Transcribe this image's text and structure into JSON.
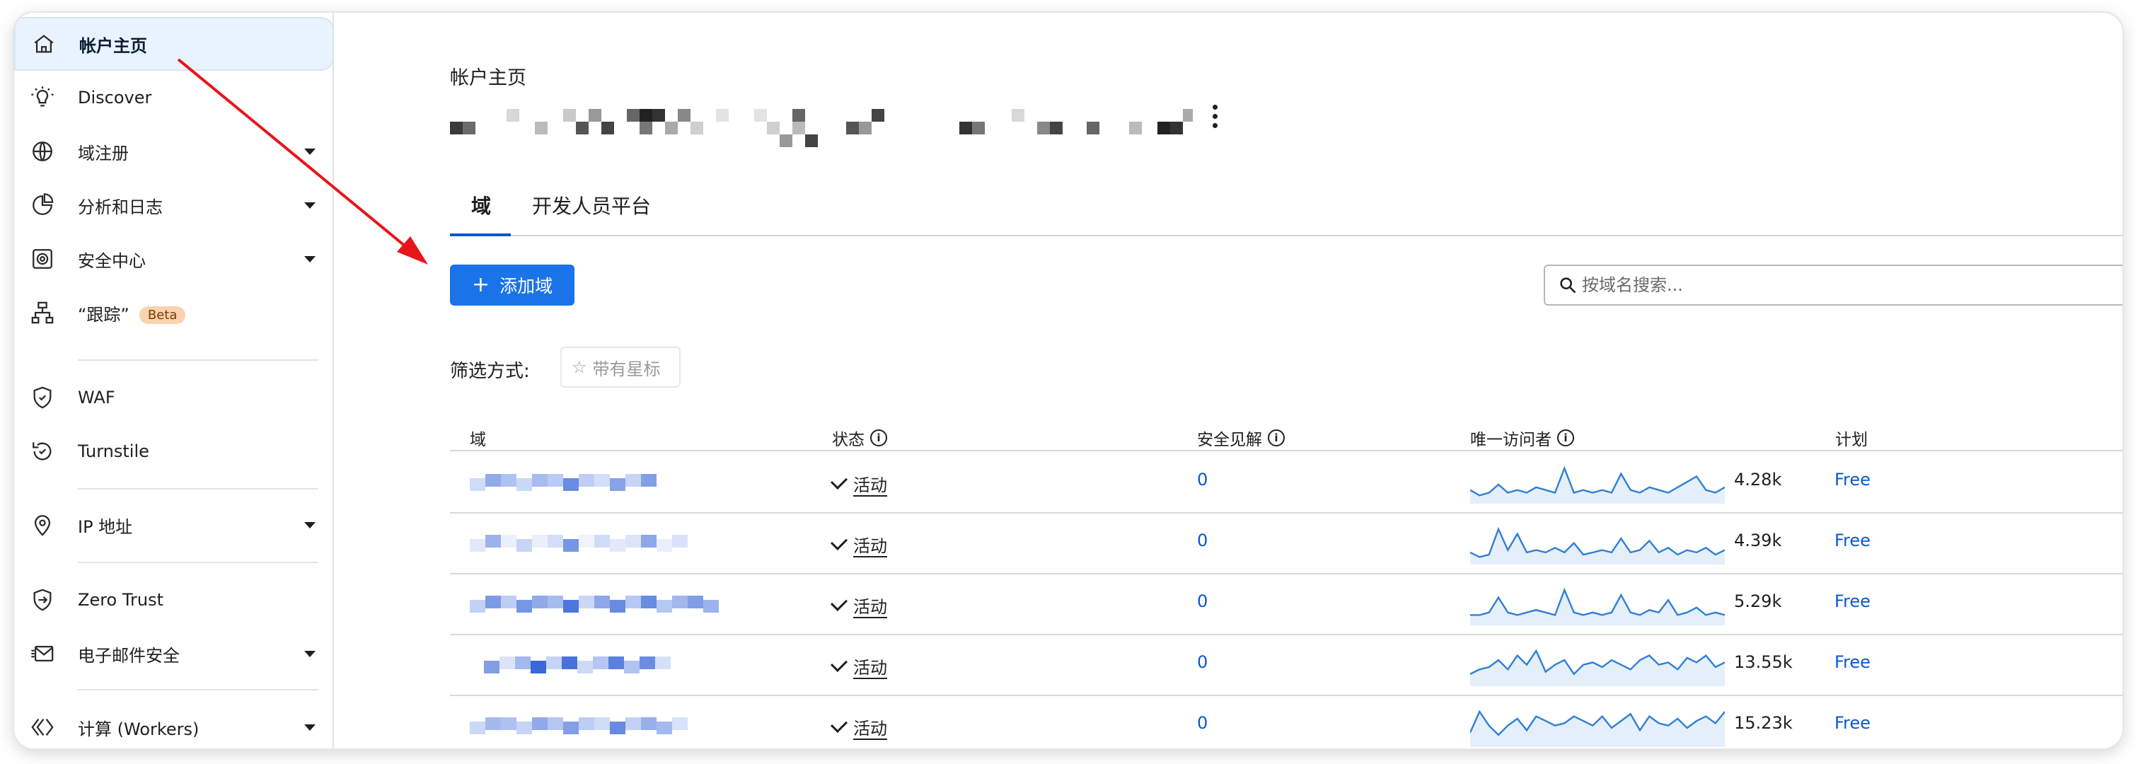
{
  "sidebar": {
    "items": [
      {
        "label": "帐户主页",
        "icon": "home-icon",
        "active": true
      },
      {
        "label": "Discover",
        "icon": "lightbulb-icon"
      },
      {
        "label": "域注册",
        "icon": "globe-icon",
        "expandable": true
      },
      {
        "label": "分析和日志",
        "icon": "pie-chart-icon",
        "expandable": true
      },
      {
        "label": "安全中心",
        "icon": "shield-icon",
        "expandable": true
      },
      {
        "label": "“跟踪”",
        "icon": "sitemap-icon",
        "badge": "Beta"
      },
      {
        "label": "WAF",
        "icon": "waf-icon"
      },
      {
        "label": "Turnstile",
        "icon": "turnstile-icon"
      },
      {
        "label": "IP 地址",
        "icon": "location-pin-icon",
        "expandable": true
      },
      {
        "label": "Zero Trust",
        "icon": "zero-trust-icon"
      },
      {
        "label": "电子邮件安全",
        "icon": "email-icon",
        "expandable": true
      },
      {
        "label": "计算 (Workers)",
        "icon": "workers-icon",
        "expandable": true
      }
    ]
  },
  "header": {
    "title": "帐户主页"
  },
  "tabs": [
    {
      "label": "域",
      "active": true
    },
    {
      "label": "开发人员平台",
      "active": false
    }
  ],
  "toolbar": {
    "add_label": "添加域",
    "search_placeholder": "按域名搜索..."
  },
  "filter": {
    "label": "筛选方式:",
    "starred_label": "带有星标"
  },
  "table": {
    "columns": {
      "domain": "域",
      "status": "状态",
      "insights": "安全见解",
      "visitors": "唯一访问者",
      "plan": "计划"
    },
    "rows": [
      {
        "status": "活动",
        "insights": "0",
        "visitors": "4.28k",
        "plan": "Free",
        "trend": [
          4,
          2,
          3,
          6,
          3,
          4,
          3,
          5,
          4,
          3,
          12,
          3,
          4,
          3,
          4,
          3,
          10,
          4,
          3,
          5,
          4,
          3,
          5,
          7,
          9,
          4,
          3,
          5
        ]
      },
      {
        "status": "活动",
        "insights": "0",
        "visitors": "4.39k",
        "plan": "Free",
        "trend": [
          4,
          2,
          3,
          14,
          5,
          12,
          4,
          5,
          4,
          6,
          4,
          8,
          3,
          4,
          5,
          4,
          10,
          4,
          5,
          9,
          4,
          6,
          3,
          5,
          4,
          6,
          3,
          5
        ]
      },
      {
        "status": "活动",
        "insights": "0",
        "visitors": "5.29k",
        "plan": "Free",
        "trend": [
          3,
          3,
          4,
          10,
          4,
          3,
          4,
          5,
          4,
          3,
          13,
          4,
          3,
          4,
          3,
          4,
          11,
          4,
          3,
          5,
          4,
          9,
          3,
          4,
          6,
          3,
          4,
          3
        ]
      },
      {
        "status": "活动",
        "insights": "0",
        "visitors": "13.55k",
        "plan": "Free",
        "trend": [
          4,
          6,
          7,
          10,
          6,
          12,
          8,
          14,
          5,
          8,
          10,
          4,
          8,
          9,
          7,
          10,
          8,
          6,
          10,
          12,
          8,
          9,
          6,
          11,
          9,
          12,
          7,
          9
        ]
      },
      {
        "status": "活动",
        "insights": "0",
        "visitors": "15.23k",
        "plan": "Free",
        "trend": [
          5,
          14,
          8,
          4,
          8,
          11,
          6,
          12,
          10,
          8,
          9,
          12,
          10,
          8,
          12,
          7,
          10,
          13,
          6,
          12,
          9,
          8,
          11,
          7,
          10,
          12,
          9,
          14
        ]
      }
    ]
  },
  "colors": {
    "accent": "#1a73e8",
    "link": "#0b57d0",
    "spark_line": "#2f7fd6",
    "spark_fill": "#e5eff9",
    "active_nav_bg": "#e9f3fd",
    "beta_bg": "#fbd3ae",
    "annotation_arrow": "#e8141c"
  }
}
